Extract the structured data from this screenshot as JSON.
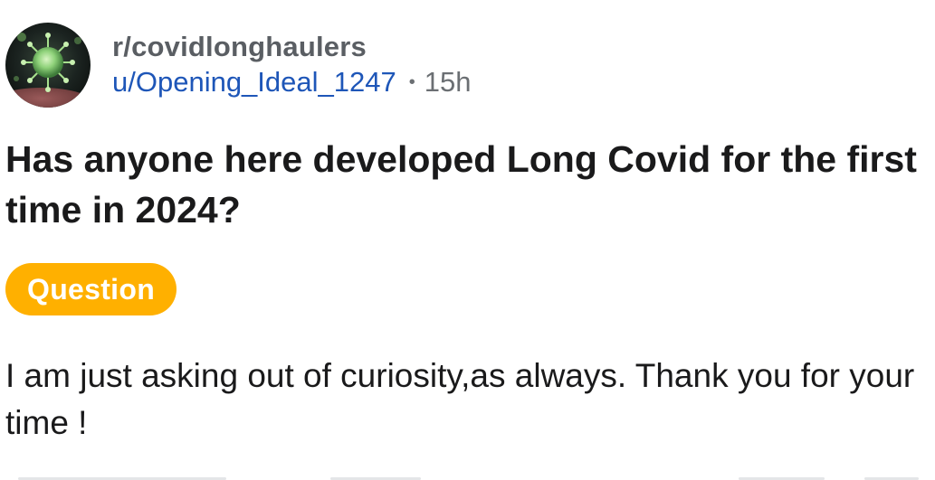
{
  "header": {
    "subreddit": "r/covidlonghaulers",
    "author": "u/Opening_Ideal_1247",
    "separator": "•",
    "age": "15h"
  },
  "post": {
    "title": "Has anyone here developed Long Covid for the first time in 2024?",
    "flair": "Question",
    "flair_color": "#ffb000",
    "body": "I am just asking out of curiosity,as always. Thank you for your time !"
  },
  "colors": {
    "subreddit": "#5a5e63",
    "author": "#1e56b8",
    "text": "#1a1a1b"
  },
  "icons": {
    "avatar": "virus-community-avatar"
  }
}
